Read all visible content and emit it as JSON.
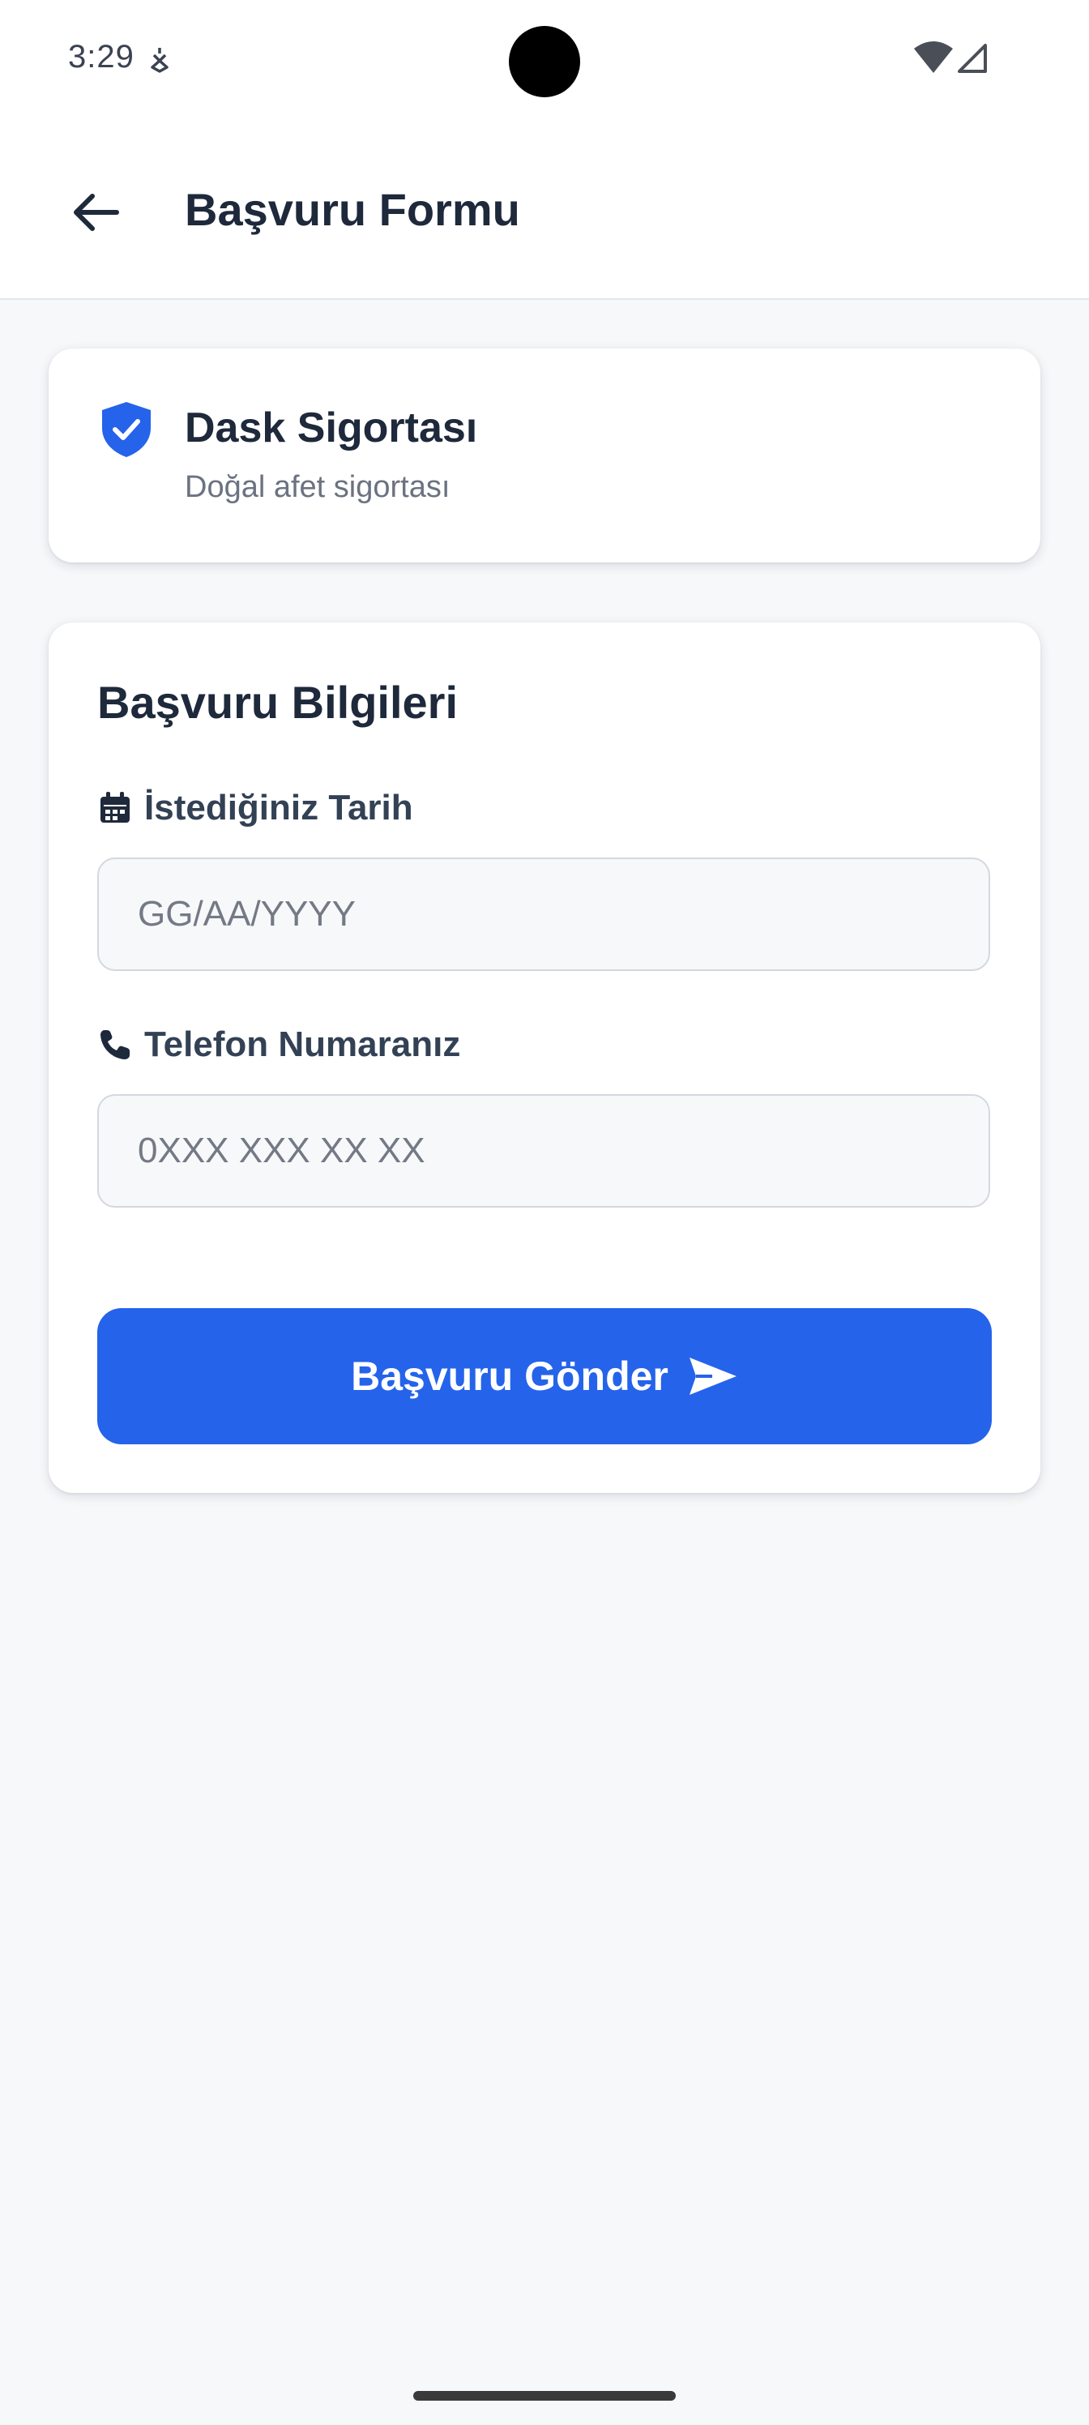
{
  "status_bar": {
    "time": "3:29",
    "icons": [
      "notification-icon",
      "wifi-icon",
      "signal-icon"
    ]
  },
  "app_bar": {
    "title": "Başvuru Formu",
    "back_icon": "arrow-left-icon"
  },
  "insurance_card": {
    "icon": "shield-check-icon",
    "title": "Dask Sigortası",
    "subtitle": "Doğal afet sigortası"
  },
  "form": {
    "title": "Başvuru Bilgileri",
    "date_field": {
      "icon": "calendar-icon",
      "label": "İstediğiniz Tarih",
      "placeholder": "GG/AA/YYYY",
      "value": ""
    },
    "phone_field": {
      "icon": "phone-icon",
      "label": "Telefon Numaranız",
      "placeholder": "0XXX XXX XX XX",
      "value": ""
    },
    "submit_label": "Başvuru Gönder",
    "submit_icon": "send-icon"
  },
  "colors": {
    "accent": "#2563eb",
    "background": "#f7f8fa",
    "text": "#1e293b"
  }
}
